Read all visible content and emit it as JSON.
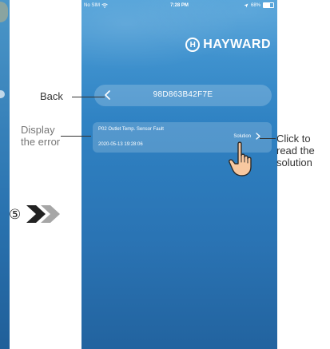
{
  "status_bar": {
    "carrier": "No SIM",
    "time": "7:28 PM",
    "battery": "68%",
    "battery_level": 0.68
  },
  "brand": {
    "logo_letter": "H",
    "name": "HAYWARD"
  },
  "header": {
    "device_id": "98D863B42F7E"
  },
  "error_entry": {
    "message": "P02 Outlet Temp. Sensor Fault",
    "timestamp": "2020-05-13 19:28:06",
    "solution_label": "Solution"
  },
  "annotations": {
    "back": "Back",
    "display_line1": "Display",
    "display_line2": "the error",
    "click_line1": "Click to",
    "click_line2": "read the",
    "click_line3": "solution",
    "step": "⑤"
  },
  "icons": {
    "wifi": "wifi-icon",
    "location": "location-arrow-icon",
    "back": "chevron-left-icon",
    "solution": "chevron-right-icon",
    "hand": "pointing-hand-icon",
    "step_arrows": "double-chevron-right-icon"
  },
  "colors": {
    "app_background_top": "#4ea0d8",
    "app_background_bottom": "#22639f",
    "text": "#ffffff",
    "annotation_text": "#333333",
    "annotation_muted": "#777777",
    "step_arrow_dark": "#222222",
    "step_arrow_light": "#a6a6a6"
  }
}
